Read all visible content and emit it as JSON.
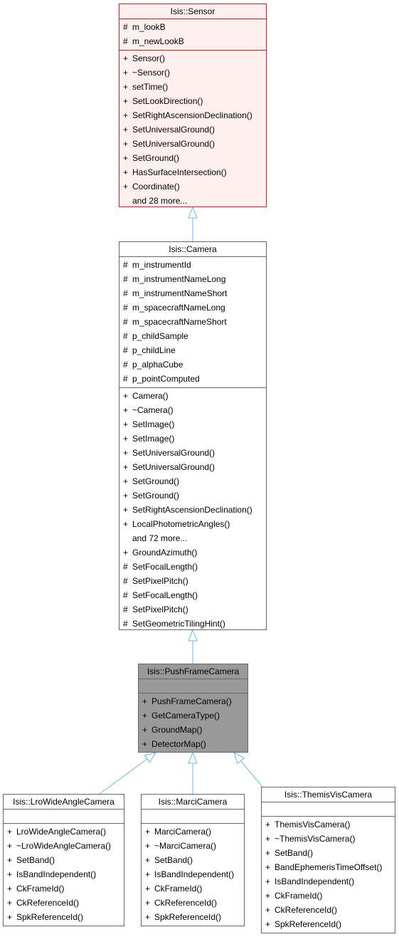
{
  "diagram": {
    "type": "class-inheritance-graph",
    "edge_color": "#63b8ff",
    "classes": {
      "sensor": {
        "name": "Isis::Sensor",
        "highlight": "red-border",
        "attributes": [
          {
            "vis": "#",
            "name": "m_lookB"
          },
          {
            "vis": "#",
            "name": "m_newLookB"
          }
        ],
        "methods": [
          {
            "vis": "+",
            "name": "Sensor()"
          },
          {
            "vis": "+",
            "name": "~Sensor()"
          },
          {
            "vis": "+",
            "name": "setTime()"
          },
          {
            "vis": "+",
            "name": "SetLookDirection()"
          },
          {
            "vis": "+",
            "name": "SetRightAscensionDeclination()"
          },
          {
            "vis": "+",
            "name": "SetUniversalGround()"
          },
          {
            "vis": "+",
            "name": "SetUniversalGround()"
          },
          {
            "vis": "+",
            "name": "SetGround()"
          },
          {
            "vis": "+",
            "name": "HasSurfaceIntersection()"
          },
          {
            "vis": "+",
            "name": "Coordinate()"
          },
          {
            "vis": "",
            "name": "and 28 more..."
          }
        ]
      },
      "camera": {
        "name": "Isis::Camera",
        "attributes": [
          {
            "vis": "#",
            "name": "m_instrumentId"
          },
          {
            "vis": "#",
            "name": "m_instrumentNameLong"
          },
          {
            "vis": "#",
            "name": "m_instrumentNameShort"
          },
          {
            "vis": "#",
            "name": "m_spacecraftNameLong"
          },
          {
            "vis": "#",
            "name": "m_spacecraftNameShort"
          },
          {
            "vis": "#",
            "name": "p_childSample"
          },
          {
            "vis": "#",
            "name": "p_childLine"
          },
          {
            "vis": "#",
            "name": "p_alphaCube"
          },
          {
            "vis": "#",
            "name": "p_pointComputed"
          }
        ],
        "methods": [
          {
            "vis": "+",
            "name": "Camera()"
          },
          {
            "vis": "+",
            "name": "~Camera()"
          },
          {
            "vis": "+",
            "name": "SetImage()"
          },
          {
            "vis": "+",
            "name": "SetImage()"
          },
          {
            "vis": "+",
            "name": "SetUniversalGround()"
          },
          {
            "vis": "+",
            "name": "SetUniversalGround()"
          },
          {
            "vis": "+",
            "name": "SetGround()"
          },
          {
            "vis": "+",
            "name": "SetGround()"
          },
          {
            "vis": "+",
            "name": "SetRightAscensionDeclination()"
          },
          {
            "vis": "+",
            "name": "LocalPhotometricAngles()"
          },
          {
            "vis": "",
            "name": "and 72 more..."
          },
          {
            "vis": "+",
            "name": "GroundAzimuth()"
          },
          {
            "vis": "#",
            "name": "SetFocalLength()"
          },
          {
            "vis": "#",
            "name": "SetPixelPitch()"
          },
          {
            "vis": "#",
            "name": "SetFocalLength()"
          },
          {
            "vis": "#",
            "name": "SetPixelPitch()"
          },
          {
            "vis": "#",
            "name": "SetGeometricTilingHint()"
          }
        ]
      },
      "pushframe": {
        "name": "Isis::PushFrameCamera",
        "highlight": "current-gray",
        "attributes": [],
        "methods": [
          {
            "vis": "+",
            "name": "PushFrameCamera()"
          },
          {
            "vis": "+",
            "name": "GetCameraType()"
          },
          {
            "vis": "+",
            "name": "GroundMap()"
          },
          {
            "vis": "+",
            "name": "DetectorMap()"
          }
        ]
      },
      "lro": {
        "name": "Isis::LroWideAngleCamera",
        "attributes": [],
        "methods": [
          {
            "vis": "+",
            "name": "LroWideAngleCamera()"
          },
          {
            "vis": "+",
            "name": "~LroWideAngleCamera()"
          },
          {
            "vis": "+",
            "name": "SetBand()"
          },
          {
            "vis": "+",
            "name": "IsBandIndependent()"
          },
          {
            "vis": "+",
            "name": "CkFrameId()"
          },
          {
            "vis": "+",
            "name": "CkReferenceId()"
          },
          {
            "vis": "+",
            "name": "SpkReferenceId()"
          }
        ]
      },
      "marci": {
        "name": "Isis::MarciCamera",
        "attributes": [],
        "methods": [
          {
            "vis": "+",
            "name": "MarciCamera()"
          },
          {
            "vis": "+",
            "name": "~MarciCamera()"
          },
          {
            "vis": "+",
            "name": "SetBand()"
          },
          {
            "vis": "+",
            "name": "IsBandIndependent()"
          },
          {
            "vis": "+",
            "name": "CkFrameId()"
          },
          {
            "vis": "+",
            "name": "CkReferenceId()"
          },
          {
            "vis": "+",
            "name": "SpkReferenceId()"
          }
        ]
      },
      "themis": {
        "name": "Isis::ThemisVisCamera",
        "attributes": [],
        "methods": [
          {
            "vis": "+",
            "name": "ThemisVisCamera()"
          },
          {
            "vis": "+",
            "name": "~ThemisVisCamera()"
          },
          {
            "vis": "+",
            "name": "SetBand()"
          },
          {
            "vis": "+",
            "name": "BandEphemerisTimeOffset()"
          },
          {
            "vis": "+",
            "name": "IsBandIndependent()"
          },
          {
            "vis": "+",
            "name": "CkFrameId()"
          },
          {
            "vis": "+",
            "name": "CkReferenceId()"
          },
          {
            "vis": "+",
            "name": "SpkReferenceId()"
          }
        ]
      }
    },
    "edges": [
      {
        "from": "camera",
        "to": "sensor",
        "kind": "inherits"
      },
      {
        "from": "pushframe",
        "to": "camera",
        "kind": "inherits"
      },
      {
        "from": "lro",
        "to": "pushframe",
        "kind": "inherits"
      },
      {
        "from": "marci",
        "to": "pushframe",
        "kind": "inherits"
      },
      {
        "from": "themis",
        "to": "pushframe",
        "kind": "inherits"
      }
    ]
  }
}
